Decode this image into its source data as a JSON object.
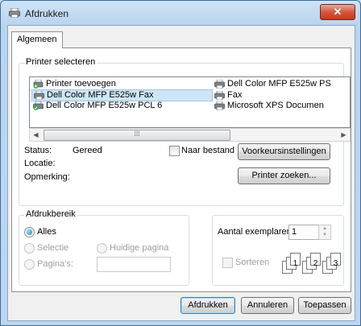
{
  "window": {
    "title": "Afdrukken"
  },
  "tabs": [
    {
      "label": "Algemeen"
    }
  ],
  "printer_select": {
    "group_label": "Printer selecteren",
    "printers_col1": [
      "Printer toevoegen",
      "Dell Color MFP E525w Fax",
      "Dell Color MFP E525w PCL 6"
    ],
    "printers_col2": [
      "Dell Color MFP E525w PS",
      "Fax",
      "Microsoft XPS Documen"
    ],
    "selected_printer": "Dell Color MFP E525w Fax",
    "status_label": "Status:",
    "status_value": "Gereed",
    "location_label": "Locatie:",
    "comment_label": "Opmerking:",
    "print_to_file_label": "Naar bestand",
    "preferences_button": "Voorkeursinstellingen",
    "find_printer_button": "Printer zoeken..."
  },
  "page_range": {
    "group_label": "Afdrukbereik",
    "all_label": "Alles",
    "selection_label": "Selectie",
    "current_page_label": "Huidige pagina",
    "pages_label": "Pagina's:",
    "selected": "Alles"
  },
  "copies": {
    "label": "Aantal exemplaren:",
    "value": "1",
    "collate_label": "Sorteren"
  },
  "footer": {
    "print_button": "Afdrukken",
    "cancel_button": "Annuleren",
    "apply_button": "Toepassen"
  },
  "icons": {
    "title": "printer-icon",
    "close": "close-icon",
    "add_printer": "add-printer-icon",
    "printer": "printer-icon",
    "scroll_left": "arrow-left-icon",
    "scroll_right": "arrow-right-icon"
  },
  "colors": {
    "accent": "#3c7fb1",
    "close": "#c7371c"
  }
}
